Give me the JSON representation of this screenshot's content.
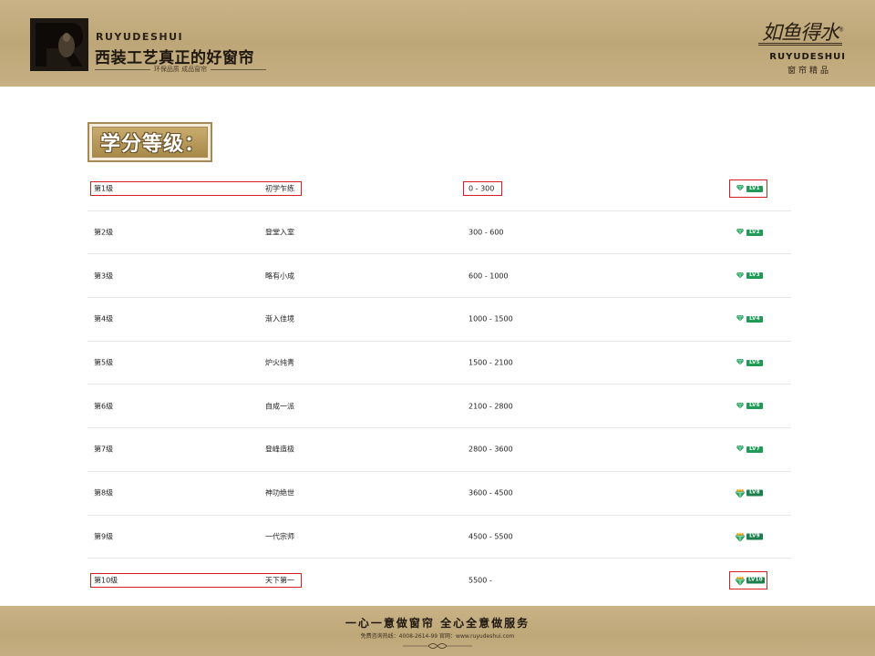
{
  "header": {
    "brand_en": "RUYUDESHUI",
    "slogan": "西装工艺真正的好窗帘",
    "subslogan": "环保品质  成品窗帘",
    "right_logo_cn": "如鱼得水",
    "right_logo_mark": "®",
    "right_logo_en": "RUYUDESHUI",
    "right_logo_sub": "窗帘精品"
  },
  "title": "学分等级：",
  "levels": [
    {
      "level": "第1级",
      "name": "初学乍练",
      "range": "0 - 300",
      "badge": "LV1",
      "icon": "gem-icon",
      "highlight": true
    },
    {
      "level": "第2级",
      "name": "登堂入室",
      "range": "300 - 600",
      "badge": "LV2",
      "icon": "gem-icon",
      "highlight": false
    },
    {
      "level": "第3级",
      "name": "略有小成",
      "range": "600 - 1000",
      "badge": "LV3",
      "icon": "gem-icon",
      "highlight": false
    },
    {
      "level": "第4级",
      "name": "渐入佳境",
      "range": "1000 - 1500",
      "badge": "LV4",
      "icon": "gem-icon",
      "highlight": false
    },
    {
      "level": "第5级",
      "name": "炉火纯青",
      "range": "1500 - 2100",
      "badge": "LV5",
      "icon": "gem-icon",
      "highlight": false
    },
    {
      "level": "第6级",
      "name": "自成一派",
      "range": "2100 - 2800",
      "badge": "LV6",
      "icon": "gem-icon",
      "highlight": false
    },
    {
      "level": "第7级",
      "name": "登峰造极",
      "range": "2800 - 3600",
      "badge": "LV7",
      "icon": "gem-icon",
      "highlight": false
    },
    {
      "level": "第8级",
      "name": "神功绝世",
      "range": "3600 - 4500",
      "badge": "LV8",
      "icon": "crown-gem-icon",
      "highlight": false
    },
    {
      "level": "第9级",
      "name": "一代宗师",
      "range": "4500 - 5500",
      "badge": "LV9",
      "icon": "crown-gem-icon",
      "highlight": false
    },
    {
      "level": "第10级",
      "name": "天下第一",
      "range": "5500 -",
      "badge": "LV10",
      "icon": "crown-gem-icon",
      "highlight": true
    }
  ],
  "footer": {
    "slogan": "一心一意做窗帘   全心全意做服务",
    "contact": "免费咨询热线：4008-2614-99   官网：www.ruyudeshui.com"
  },
  "colors": {
    "gold": "#c4ad80",
    "highlight": "#d42020",
    "badge_green": "#1f9a57",
    "crown_orange": "#f0a020"
  }
}
